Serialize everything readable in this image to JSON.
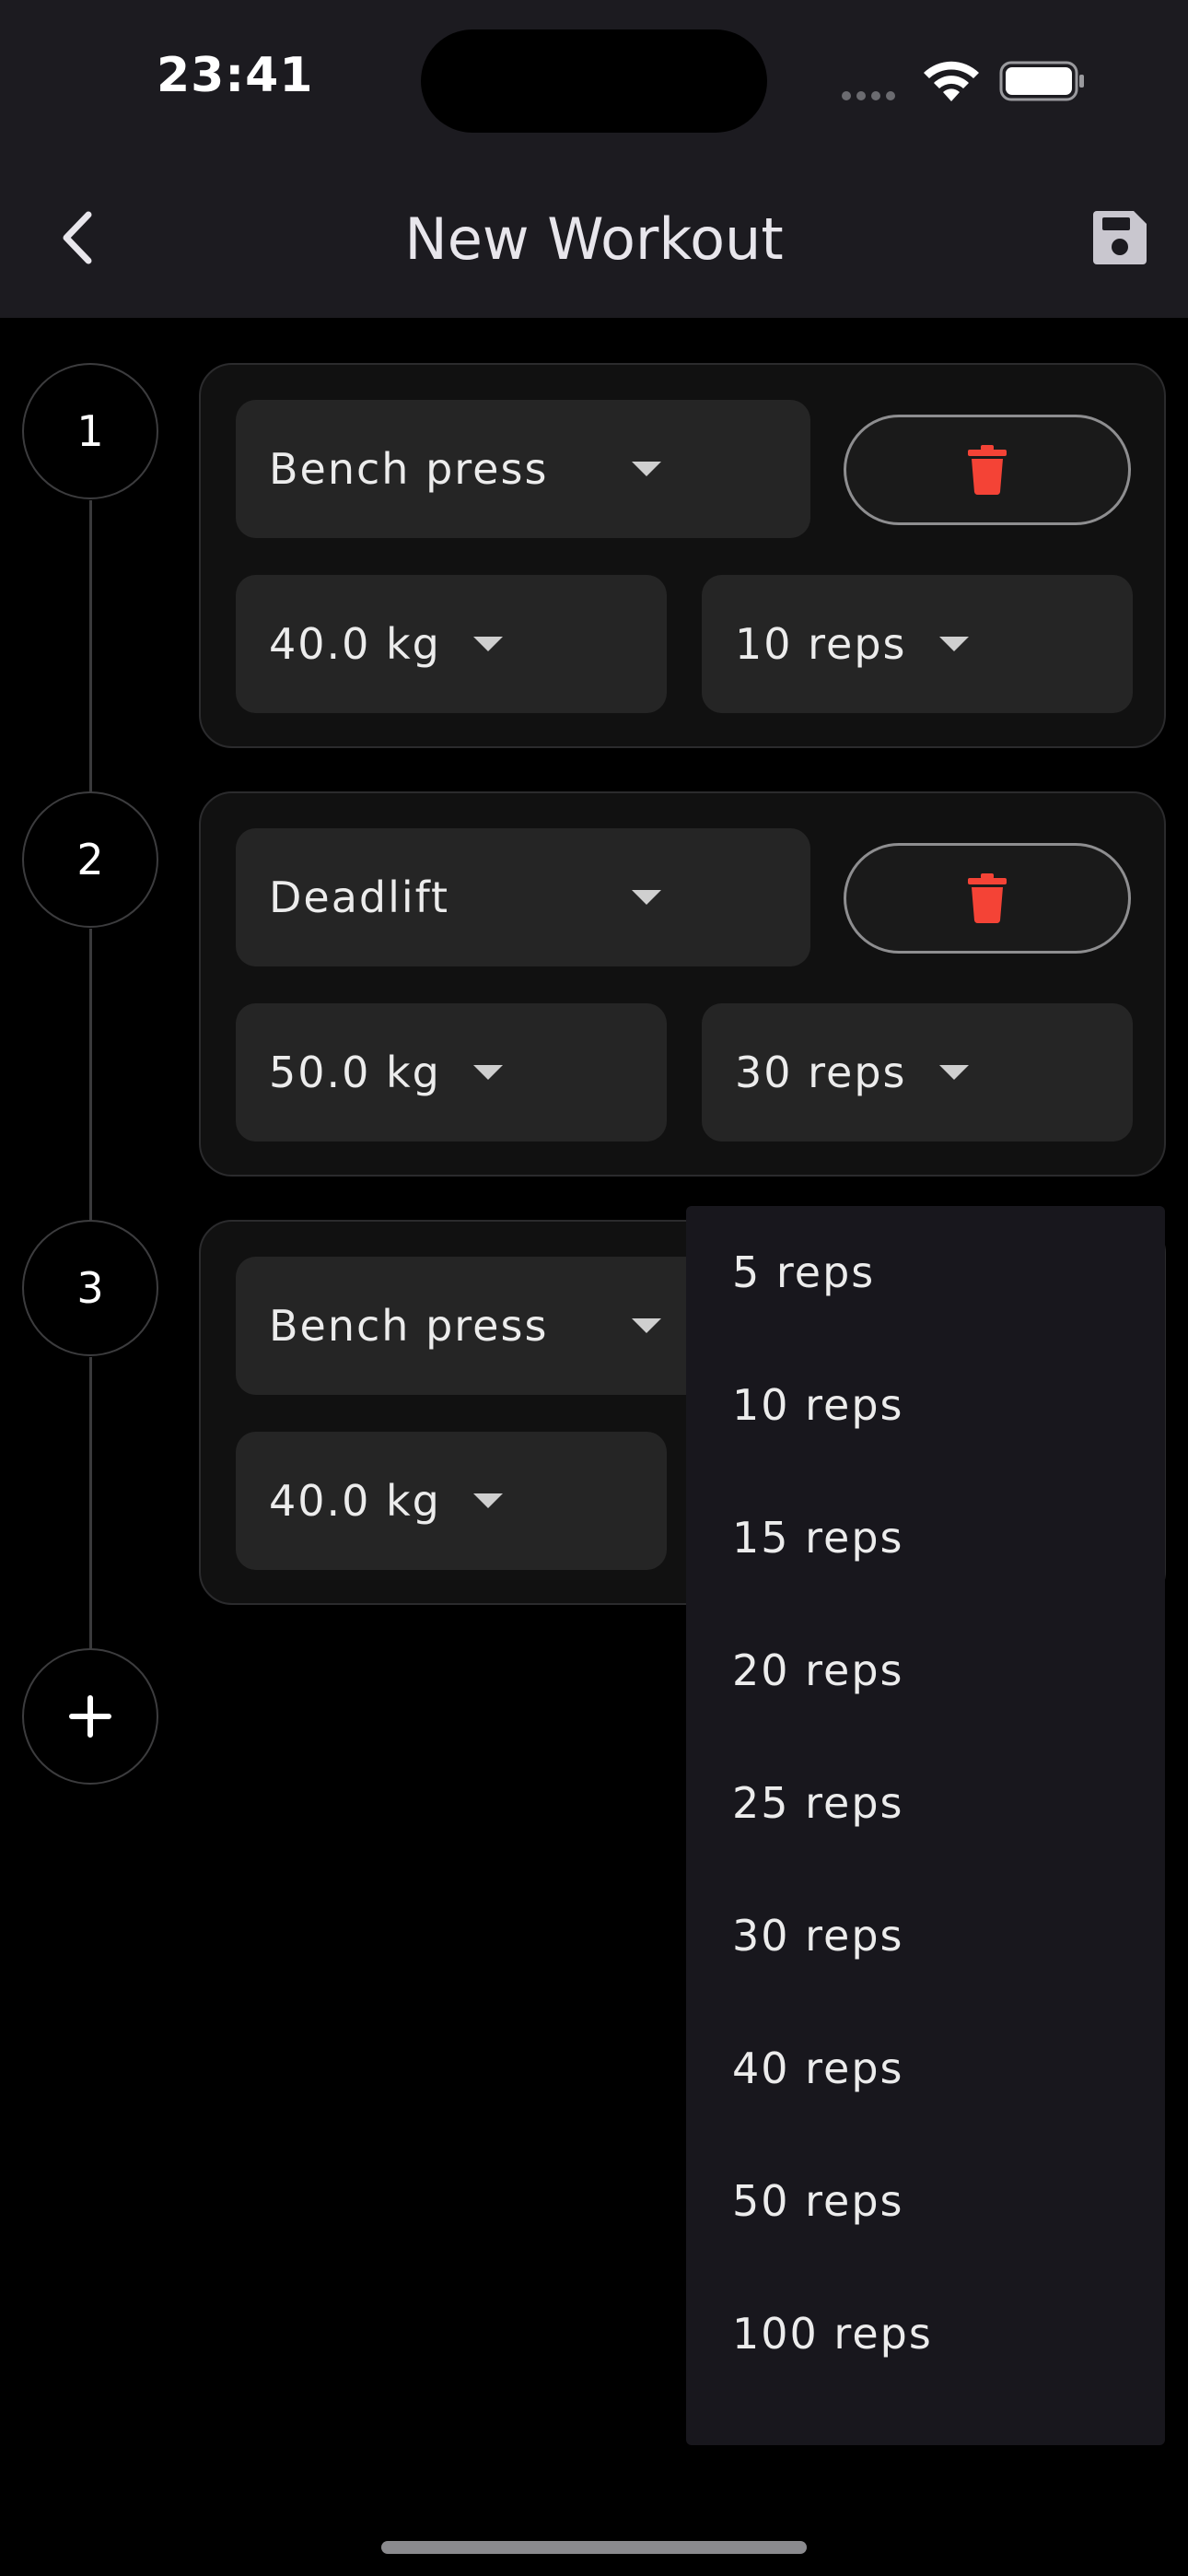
{
  "status_bar": {
    "time": "23:41"
  },
  "app_bar": {
    "title": "New Workout"
  },
  "steps": [
    {
      "number": "1",
      "exercise": "Bench press",
      "weight": "40.0 kg",
      "reps": "10 reps"
    },
    {
      "number": "2",
      "exercise": "Deadlift",
      "weight": "50.0 kg",
      "reps": "30 reps"
    },
    {
      "number": "3",
      "exercise": "Bench press",
      "weight": "40.0 kg",
      "reps": ""
    }
  ],
  "reps_menu": {
    "options": [
      "5 reps",
      "10 reps",
      "15 reps",
      "20 reps",
      "25 reps",
      "30 reps",
      "40 reps",
      "50 reps",
      "100 reps"
    ]
  },
  "colors": {
    "delete_icon": "#f44336",
    "bar_background": "#1c1b20",
    "menu_background": "#18171d"
  },
  "icons": {
    "back": "chevron-left-icon",
    "save": "floppy-disk-icon",
    "delete": "trash-icon",
    "add": "plus-icon"
  }
}
